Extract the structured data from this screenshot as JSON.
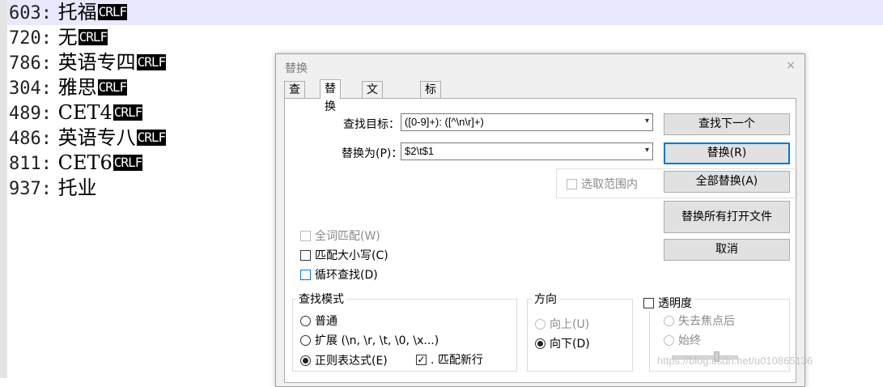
{
  "editor": {
    "lines": [
      {
        "num": "603:",
        "text": "托福",
        "eol": "CRLF"
      },
      {
        "num": "720:",
        "text": "无",
        "eol": "CRLF"
      },
      {
        "num": "786:",
        "text": "英语专四",
        "eol": "CRLF"
      },
      {
        "num": "304:",
        "text": "雅思",
        "eol": "CRLF"
      },
      {
        "num": "489:",
        "text": "CET4",
        "eol": "CRLF"
      },
      {
        "num": "486:",
        "text": "英语专八",
        "eol": "CRLF"
      },
      {
        "num": "811:",
        "text": "CET6",
        "eol": "CRLF"
      },
      {
        "num": "937:",
        "text": "托业",
        "eol": ""
      }
    ]
  },
  "dialog": {
    "title": "替换",
    "close_glyph": "×",
    "tabs": [
      "查找",
      "替换",
      "文件查找",
      "标记"
    ],
    "find_label": "查找目标：",
    "find_value": "([0-9]+): ([^\\n\\r]+)",
    "replace_label": "替换为(P)：",
    "replace_value": "$2\\t$1",
    "in_selection": "选取范围内",
    "buttons": {
      "find_next": "查找下一个",
      "replace": "替换(R)",
      "replace_all": "全部替换(A)",
      "replace_all_open": "替换所有打开文件",
      "cancel": "取消"
    },
    "options": {
      "whole_word": "全词匹配(W)",
      "match_case": "匹配大小写(C)",
      "wrap_around": "循环查找(D)"
    },
    "search_mode": {
      "title": "查找模式",
      "normal": "普通",
      "extended": "扩展 (\\n, \\r, \\t, \\0, \\x...)",
      "regex": "正则表达式(E)",
      "dot_newline": ". 匹配新行",
      "check_glyph": "✓"
    },
    "direction": {
      "title": "方向",
      "up": "向上(U)",
      "down": "向下(D)"
    },
    "transparency": {
      "title": "透明度",
      "on_lose_focus": "失去焦点后",
      "always": "始终"
    }
  },
  "watermark": "https://blog.csdn.net/u010865136"
}
